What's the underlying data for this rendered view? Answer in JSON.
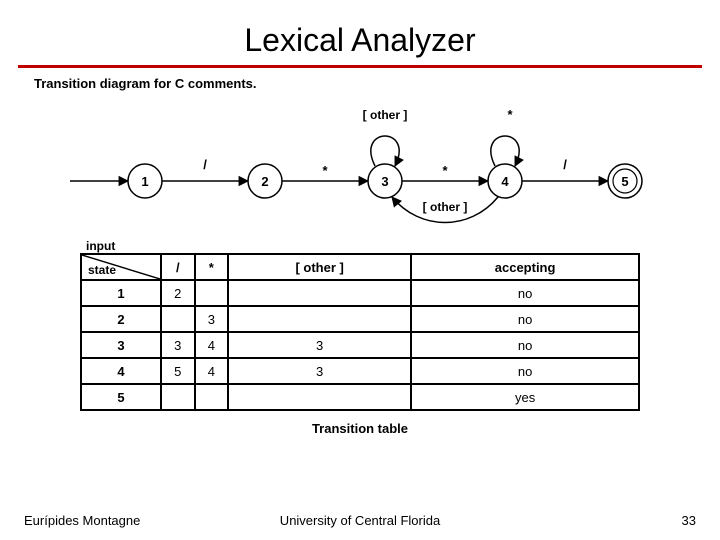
{
  "title": "Lexical Analyzer",
  "subtitle": "Transition diagram for C comments.",
  "diagram": {
    "states": [
      "1",
      "2",
      "3",
      "4",
      "5"
    ],
    "edges": {
      "e12": "/",
      "e23": "*",
      "e34": "*",
      "e45": "/",
      "loop3": "[ other ]",
      "loop4": "*",
      "back43": "[ other ]"
    }
  },
  "table": {
    "input_label": "input",
    "state_label": "state",
    "headers": [
      "/",
      "*",
      "[ other ]",
      "accepting"
    ],
    "rows": [
      {
        "state": "1",
        "cells": [
          "2",
          "",
          "",
          "no"
        ]
      },
      {
        "state": "2",
        "cells": [
          "",
          "3",
          "",
          "no"
        ]
      },
      {
        "state": "3",
        "cells": [
          "3",
          "4",
          "3",
          "no"
        ]
      },
      {
        "state": "4",
        "cells": [
          "5",
          "4",
          "3",
          "no"
        ]
      },
      {
        "state": "5",
        "cells": [
          "",
          "",
          "",
          "yes"
        ]
      }
    ],
    "caption": "Transition  table"
  },
  "footer": {
    "author": "Eurípides Montagne",
    "university": "University of Central Florida",
    "page": "33"
  }
}
